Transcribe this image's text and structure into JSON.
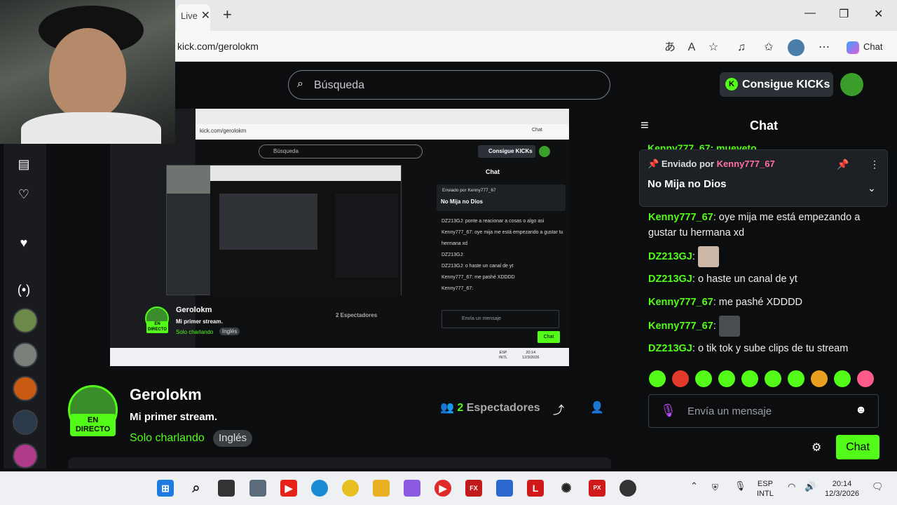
{
  "browser": {
    "tab_title": "Live",
    "new_tab": "+",
    "url": "kick.com/gerolokm",
    "copilot_label": "Chat",
    "window_controls": [
      "minimize-icon",
      "restore-icon",
      "close-icon"
    ]
  },
  "header": {
    "search_placeholder": "Búsqueda",
    "kicks_button": "Consigue KICKs"
  },
  "sidebar": {
    "icons": [
      "browse-icon",
      "heart-outline-icon",
      "heart-filled-icon",
      "live-icon"
    ]
  },
  "channel": {
    "live_badge_line1": "EN",
    "live_badge_line2": "DIRECTO",
    "name": "Gerolokm",
    "stream_title": "Mi primer stream.",
    "category": "Solo charlando",
    "language": "Inglés",
    "viewers_count": "2",
    "viewers_label": "Espectadores"
  },
  "chat": {
    "title": "Chat",
    "top_cut_text": "Kenny777_67: mueveto",
    "pinned": {
      "label_prefix": "Enviado por",
      "author": "Kenny777_67",
      "message": "No Mija no Dios"
    },
    "messages": [
      {
        "user": "Kenny777_67",
        "color": "#53fc18",
        "text": "oye mija me está empezando a gustar tu hermana xd"
      },
      {
        "user": "DZ213GJ",
        "color": "#53fc18",
        "text": "",
        "emote": true
      },
      {
        "user": "DZ213GJ",
        "color": "#53fc18",
        "text": "o haste un canal de yt"
      },
      {
        "user": "Kenny777_67",
        "color": "#53fc18",
        "text": "me pashé XDDDD"
      },
      {
        "user": "Kenny777_67",
        "color": "#53fc18",
        "text": "",
        "emote": true
      },
      {
        "user": "DZ213GJ",
        "color": "#53fc18",
        "text": "o tik tok y sube clips de tu stream"
      }
    ],
    "input_placeholder": "Envía un mensaje",
    "send_button": "Chat"
  },
  "taskbar": {
    "lang_line1": "ESP",
    "lang_line2": "INTL",
    "time": "20:14",
    "date": "12/3/2026"
  },
  "nested": {
    "url": "kick.com/gerolokm",
    "search": "Búsqueda",
    "kicks": "Consigue KICKs",
    "chat_title": "Chat",
    "pinned_label": "Enviado por Kenny777_67",
    "pinned_msg": "No Mija no Dios",
    "msgs": [
      "DZ213GJ: ponte a reacionar a cosas o algo asi",
      "Kenny777_67: oye mija me está empezando a gustar tu hermana xd",
      "DZ213GJ:",
      "DZ213GJ: o haste un canal de yt",
      "Kenny777_67: me pashé XDDDD",
      "Kenny777_67:"
    ],
    "channel_name": "Gerolokm",
    "stream_title": "Mi primer stream.",
    "category": "Solo charlando",
    "language": "Inglés",
    "viewers": "2 Espectadores",
    "input": "Envía un mensaje",
    "send": "Chat",
    "live1": "EN",
    "live2": "DIRECTO",
    "copilot": "Chat",
    "lang1": "ESP",
    "lang2": "INTL",
    "time": "20:14",
    "date": "12/3/2026"
  }
}
